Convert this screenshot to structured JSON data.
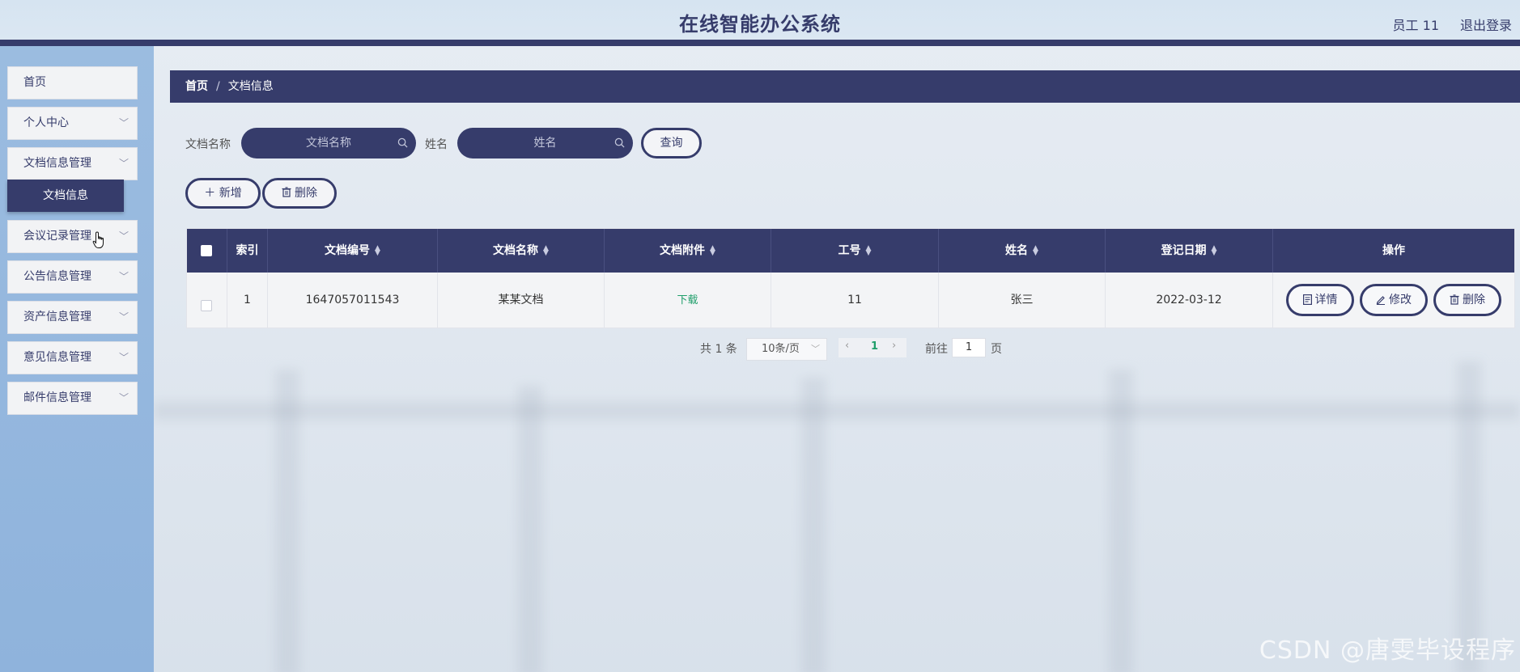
{
  "header": {
    "title": "在线智能办公系统",
    "user": "员工 11",
    "logout": "退出登录"
  },
  "sidebar": {
    "items": [
      {
        "label": "首页"
      },
      {
        "label": "个人中心"
      },
      {
        "label": "文档信息管理"
      },
      {
        "label": "会议记录管理"
      },
      {
        "label": "公告信息管理"
      },
      {
        "label": "资产信息管理"
      },
      {
        "label": "意见信息管理"
      },
      {
        "label": "邮件信息管理"
      }
    ],
    "active_sub": "文档信息"
  },
  "breadcrumb": {
    "home": "首页",
    "separator": "/",
    "current": "文档信息"
  },
  "search": {
    "doc_name_label": "文档名称",
    "doc_name_placeholder": "文档名称",
    "name_label": "姓名",
    "name_placeholder": "姓名",
    "query_button": "查询"
  },
  "actions": {
    "add": "新增",
    "delete": "删除"
  },
  "table": {
    "headers": [
      "索引",
      "文档编号",
      "文档名称",
      "文档附件",
      "工号",
      "姓名",
      "登记日期",
      "操作"
    ],
    "rows": [
      {
        "index": "1",
        "doc_no": "1647057011543",
        "doc_name": "某某文档",
        "attachment": "下载",
        "emp_no": "11",
        "name": "张三",
        "date": "2022-03-12"
      }
    ],
    "row_actions": {
      "detail": "详情",
      "edit": "修改",
      "delete": "删除"
    }
  },
  "pagination": {
    "total": "共 1 条",
    "page_size": "10条/页",
    "current_page": "1",
    "goto_label": "前往",
    "goto_value": "1",
    "page_unit": "页"
  },
  "watermark": "CSDN @唐雯毕设程序",
  "colors": {
    "primary": "#363c6b",
    "sidebar_bg": "#9bbce0",
    "link_green": "#1f9e6a"
  }
}
